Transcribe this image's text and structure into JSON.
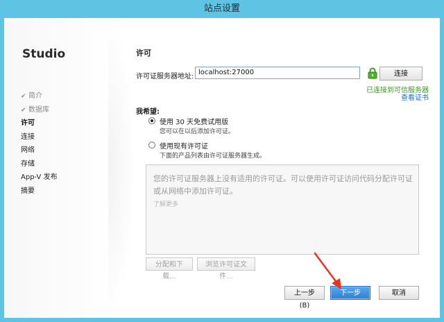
{
  "window": {
    "title": "站点设置"
  },
  "sidebar": {
    "brand": "Studio",
    "items": [
      {
        "label": "简介",
        "state": "done"
      },
      {
        "label": "数据库",
        "state": "done"
      },
      {
        "label": "许可",
        "state": "current"
      },
      {
        "label": "连接",
        "state": "pending"
      },
      {
        "label": "网络",
        "state": "pending"
      },
      {
        "label": "存储",
        "state": "pending"
      },
      {
        "label": "App-V 发布",
        "state": "pending"
      },
      {
        "label": "摘要",
        "state": "pending"
      }
    ],
    "check_glyph": "✔"
  },
  "main": {
    "title": "许可",
    "server_label": "许可证服务器地址:",
    "server_value": "localhost:27000",
    "connect_label": "连接",
    "status_connected": "已连接到可信服务器",
    "view_cert": "查看证书",
    "want_label": "我希望:",
    "option_trial": {
      "label": "使用 30 天免费试用版",
      "sub": "您可以在以后添加许可证。",
      "selected": true
    },
    "option_existing": {
      "label": "使用现有许可证",
      "sub": "下面的产品列表由许可证服务器生成。",
      "selected": false
    },
    "panel": {
      "message": "您的许可证服务器上没有适用的许可证。可以使用许可证访问代码分配许可证或从网络中添加许可证。",
      "learn_more": "了解更多"
    },
    "allocate_label": "分配和下载...",
    "browse_label": "浏览许可证文件...",
    "back_label": "上一步(B)",
    "next_label": "下一步(N)",
    "cancel_label": "取消"
  },
  "colors": {
    "titlebar": "#5fc3e4",
    "success": "#3c9a1e",
    "link": "#1f6fc5",
    "primary": "#2f7fd1",
    "annotation": "#e8321e"
  }
}
